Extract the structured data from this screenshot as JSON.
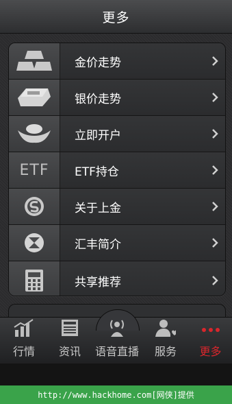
{
  "header": {
    "title": "更多"
  },
  "menu": {
    "items": [
      {
        "label": "金价走势",
        "icon": "gold-bars-icon"
      },
      {
        "label": "银价走势",
        "icon": "silver-bar-icon"
      },
      {
        "label": "立即开户",
        "icon": "ingot-icon"
      },
      {
        "label": "ETF持仓",
        "icon": "etf-icon",
        "icon_text": "ETF"
      },
      {
        "label": "关于上金",
        "icon": "logo-s-icon"
      },
      {
        "label": "汇丰简介",
        "icon": "hsbc-logo-icon"
      },
      {
        "label": "共享推荐",
        "icon": "calculator-icon"
      }
    ]
  },
  "tabbar": {
    "tabs": [
      {
        "label": "行情",
        "icon": "chart-icon",
        "active": false
      },
      {
        "label": "资讯",
        "icon": "newspaper-icon",
        "active": false
      },
      {
        "label": "语音直播",
        "icon": "broadcast-icon",
        "active": false
      },
      {
        "label": "服务",
        "icon": "service-person-icon",
        "active": false
      },
      {
        "label": "更多",
        "icon": "more-dots-icon",
        "active": true
      }
    ]
  },
  "watermark": {
    "text": "http://www.hackhome.com[网侠]提供"
  },
  "colors": {
    "active": "#d9262c",
    "watermark_bg": "#3aa34a"
  }
}
